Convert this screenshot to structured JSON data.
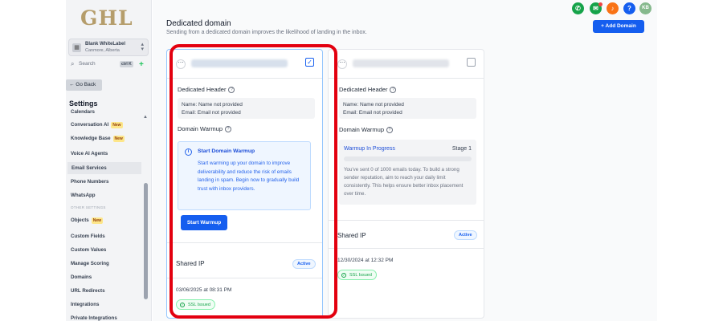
{
  "sidebar": {
    "logo": "GHL",
    "account": {
      "name": "Blank WhiteLabel",
      "location": "Canmore, Alberta"
    },
    "search": {
      "placeholder": "Search",
      "shortcut": "ctrl K"
    },
    "go_back": "← Go Back",
    "settings_heading": "Settings",
    "new_badge": "New",
    "section_other": "OTHER SETTINGS",
    "items": [
      {
        "label": "Calendars"
      },
      {
        "label": "Conversation AI",
        "badge": "New"
      },
      {
        "label": "Knowledge Base",
        "badge": "New"
      },
      {
        "label": "Voice AI Agents"
      },
      {
        "label": "Email Services",
        "active": true
      },
      {
        "label": "Phone Numbers"
      },
      {
        "label": "WhatsApp"
      },
      {
        "label": "Objects",
        "badge": "New"
      },
      {
        "label": "Custom Fields"
      },
      {
        "label": "Custom Values"
      },
      {
        "label": "Manage Scoring"
      },
      {
        "label": "Domains"
      },
      {
        "label": "URL Redirects"
      },
      {
        "label": "Integrations"
      },
      {
        "label": "Private Integrations"
      }
    ]
  },
  "header": {
    "title": "Dedicated domain",
    "subtitle": "Sending from a dedicated domain improves the likelihood of landing in the inbox.",
    "add_button": "+ Add Domain",
    "avatar_initials": "KB"
  },
  "cards": [
    {
      "dedicated_header_label": "Dedicated Header",
      "name_line": "Name: Name not provided",
      "email_line": "Email: Email not provided",
      "warmup_label": "Domain Warmup",
      "warmup_title": "Start Domain Warmup",
      "warmup_desc": "Start warming up your domain to improve deliverability and reduce the risk of emails landing in spam. Begin now to gradually build trust with inbox providers.",
      "start_button": "Start Warmup",
      "shared_ip_label": "Shared IP",
      "status": "Active",
      "date": "03/06/2025 at 08:31 PM",
      "ssl": "SSL Issued"
    },
    {
      "dedicated_header_label": "Dedicated Header",
      "name_line": "Name: Name not provided",
      "email_line": "Email: Email not provided",
      "warmup_label": "Domain Warmup",
      "progress_title": "Warmup In Progress",
      "stage": "Stage 1",
      "progress_fraction": 0,
      "progress_desc": "You've sent 0 of 1000 emails today. To build a strong sender reputation, aim to reach your daily limit consistently. This helps ensure better inbox placement over time.",
      "shared_ip_label": "Shared IP",
      "status": "Active",
      "date": "12/30/2024 at 12:32 PM",
      "ssl": "SSL Issued"
    }
  ],
  "colors": {
    "primary": "#155eef",
    "highlight": "#e3000f",
    "logo": "#b59d6b"
  }
}
